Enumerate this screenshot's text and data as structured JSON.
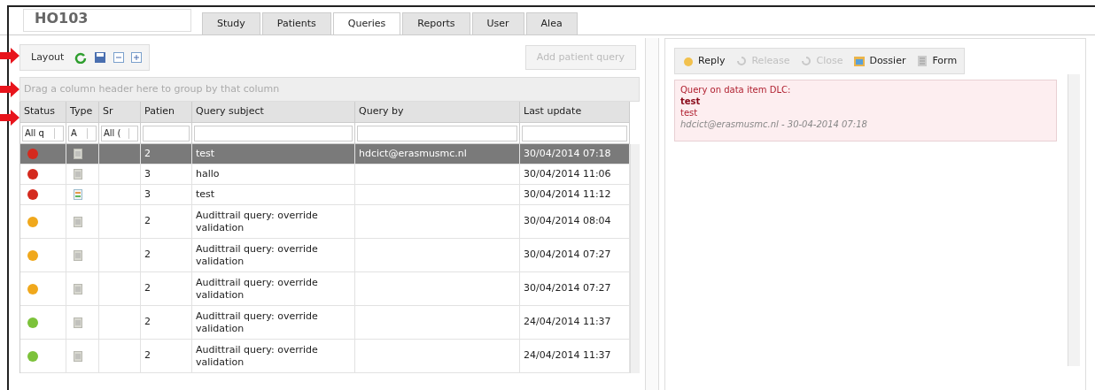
{
  "study": {
    "title": "HO103"
  },
  "tabs": [
    {
      "label": "Study",
      "selected": false
    },
    {
      "label": "Patients",
      "selected": false
    },
    {
      "label": "Queries",
      "selected": true
    },
    {
      "label": "Reports",
      "selected": false
    },
    {
      "label": "User",
      "selected": false
    },
    {
      "label": "Alea",
      "selected": false
    }
  ],
  "toolbar": {
    "layout_button": "Layout",
    "add_button": {
      "label": "Add patient query",
      "disabled": true
    }
  },
  "group_panel": "Drag a column header here to group by that column",
  "table": {
    "columns": [
      "Status",
      "Type",
      "Sr",
      "Patien",
      "Query subject",
      "Query by",
      "Last update"
    ],
    "filters": [
      "All q",
      "A",
      "All ("
    ],
    "rows": [
      {
        "color": "#d42a1e",
        "kind": "note",
        "patient": "2",
        "subject": "test",
        "query_by": "hdcict@erasmusmc.nl",
        "updated": "30/04/2014 07:18",
        "selected": true
      },
      {
        "color": "#d42a1e",
        "kind": "note",
        "patient": "3",
        "subject": "hallo",
        "query_by": "",
        "updated": "30/04/2014 11:06",
        "selected": false
      },
      {
        "color": "#d42a1e",
        "kind": "form",
        "patient": "3",
        "subject": "test",
        "query_by": "",
        "updated": "30/04/2014 11:12",
        "selected": false
      },
      {
        "color": "#f0a81c",
        "kind": "note",
        "patient": "2",
        "subject": "Audittrail query: override validation",
        "query_by": "",
        "updated": "30/04/2014 08:04",
        "selected": false
      },
      {
        "color": "#f0a81c",
        "kind": "note",
        "patient": "2",
        "subject": "Audittrail query: override validation",
        "query_by": "",
        "updated": "30/04/2014 07:27",
        "selected": false
      },
      {
        "color": "#f0a81c",
        "kind": "note",
        "patient": "2",
        "subject": "Audittrail query: override validation",
        "query_by": "",
        "updated": "30/04/2014 07:27",
        "selected": false
      },
      {
        "color": "#7cc23a",
        "kind": "note",
        "patient": "2",
        "subject": "Audittrail query: override validation",
        "query_by": "",
        "updated": "24/04/2014 11:37",
        "selected": false
      },
      {
        "color": "#7cc23a",
        "kind": "note",
        "patient": "2",
        "subject": "Audittrail query: override validation",
        "query_by": "",
        "updated": "24/04/2014 11:37",
        "selected": false
      }
    ]
  },
  "detail": {
    "actions": [
      {
        "label": "Reply",
        "disabled": false,
        "kind": "reply"
      },
      {
        "label": "Release",
        "disabled": true,
        "kind": "release"
      },
      {
        "label": "Close",
        "disabled": true,
        "kind": "close"
      },
      {
        "label": "Dossier",
        "disabled": false,
        "kind": "dossier"
      },
      {
        "label": "Form",
        "disabled": false,
        "kind": "form"
      }
    ],
    "message": {
      "heading": "Query on data item DLC:",
      "subject": "test",
      "body": "test",
      "signature": "hdcict@erasmusmc.nl - 30-04-2014 07:18"
    }
  }
}
